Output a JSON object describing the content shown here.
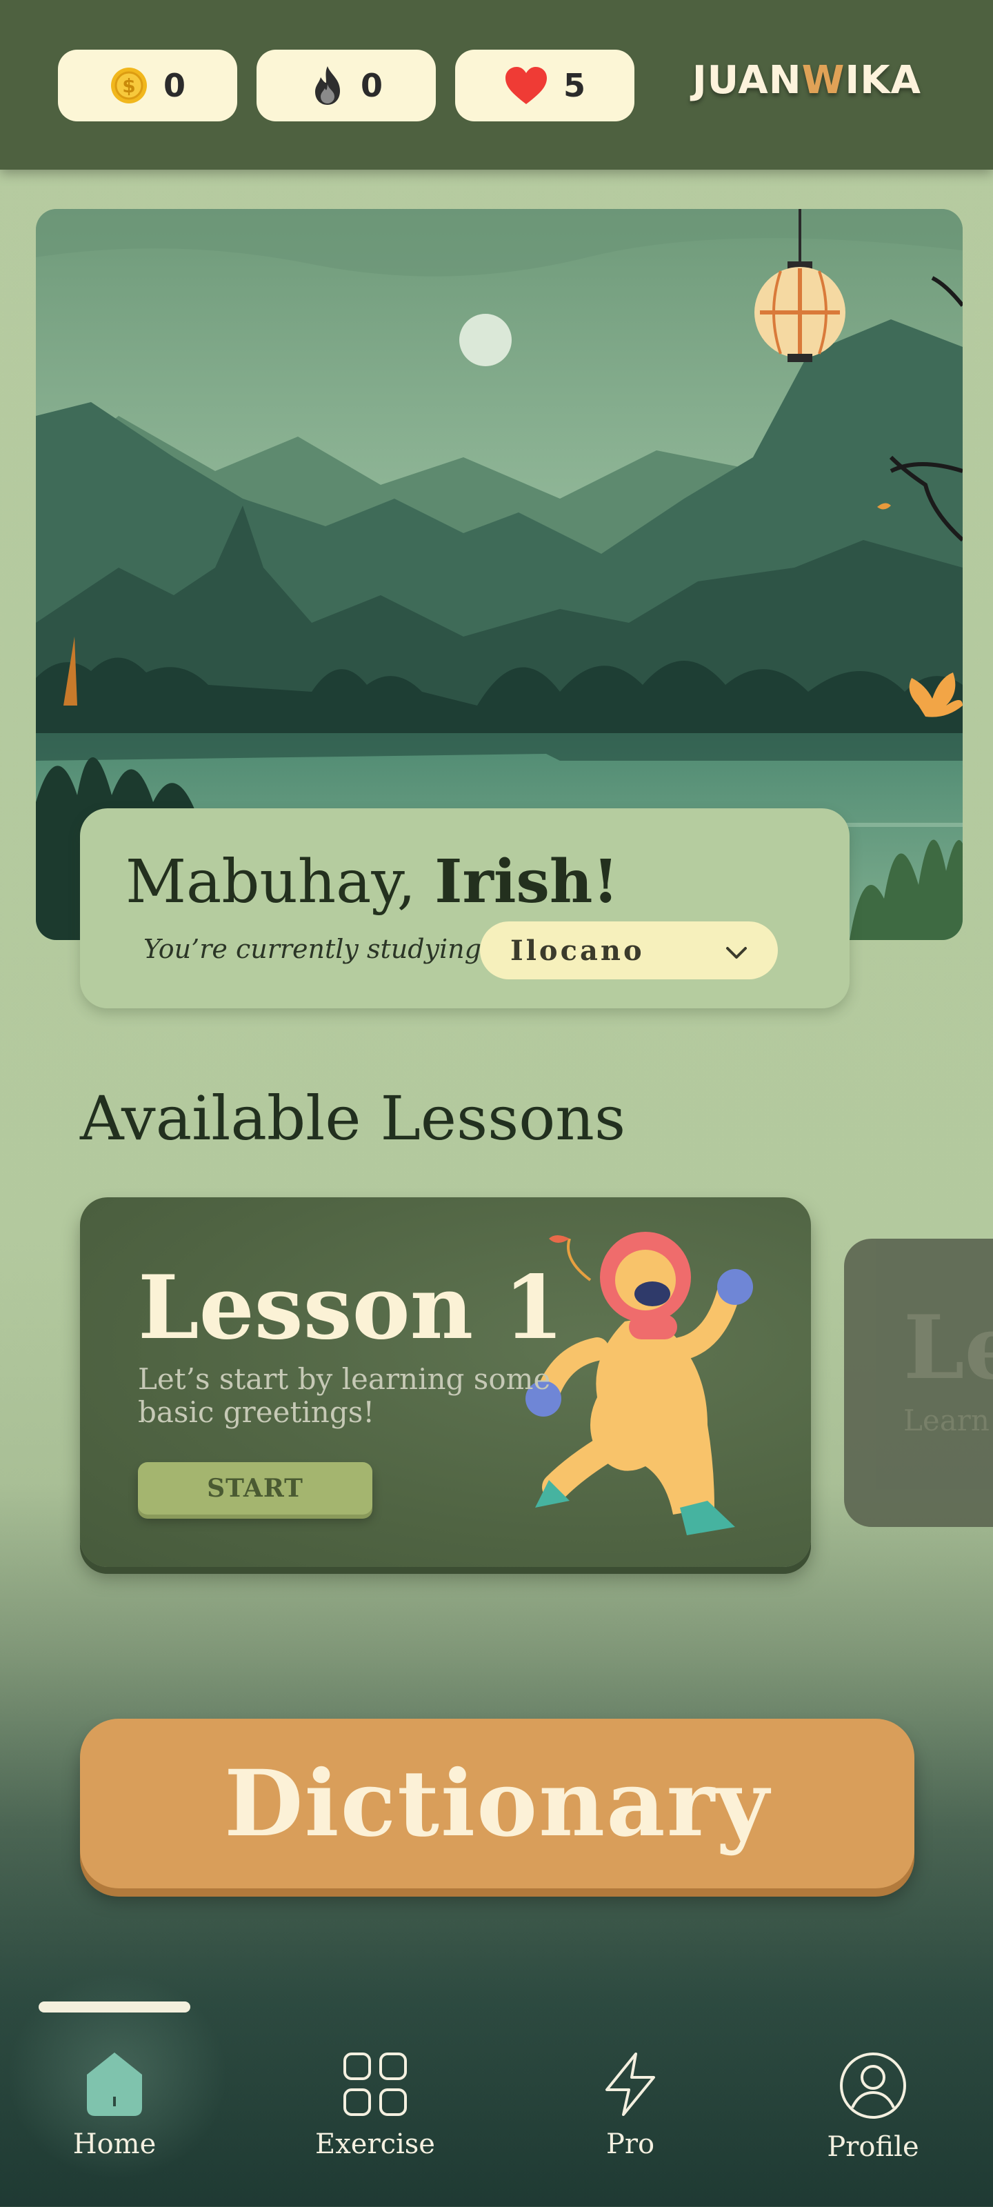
{
  "stats": {
    "coins": {
      "icon": "coin-icon",
      "value": "0"
    },
    "streak": {
      "icon": "fire-icon",
      "value": "0"
    },
    "hearts": {
      "icon": "heart-icon",
      "value": "5"
    }
  },
  "brand": {
    "logo_part1": "JUAN",
    "logo_accent": "W",
    "logo_part2": "IKA"
  },
  "greeting": {
    "salutation": "Mabuhay, ",
    "name": "Irish!",
    "studying_label": "You’re currently studying:",
    "language": "Ilocano"
  },
  "lessons": {
    "section_title": "Available Lessons",
    "items": [
      {
        "title": "Lesson 1",
        "description": "Let’s start by learning some basic greetings!",
        "button": "START"
      },
      {
        "title": "Le",
        "description": "Learn to oth"
      }
    ]
  },
  "dictionary": {
    "label": "Dictionary"
  },
  "nav": {
    "items": [
      {
        "label": "Home",
        "icon": "home-icon",
        "active": true
      },
      {
        "label": "Exercise",
        "icon": "grid-icon"
      },
      {
        "label": "Pro",
        "icon": "lightning-icon"
      },
      {
        "label": "Profile",
        "icon": "user-icon"
      }
    ]
  },
  "colors": {
    "topbar": "#4e6140",
    "background": "#b6cba0",
    "accent_orange": "#d99e5a",
    "lesson_card": "#506443",
    "start_button": "#a4b56f",
    "chip": "#fcf6d6"
  }
}
